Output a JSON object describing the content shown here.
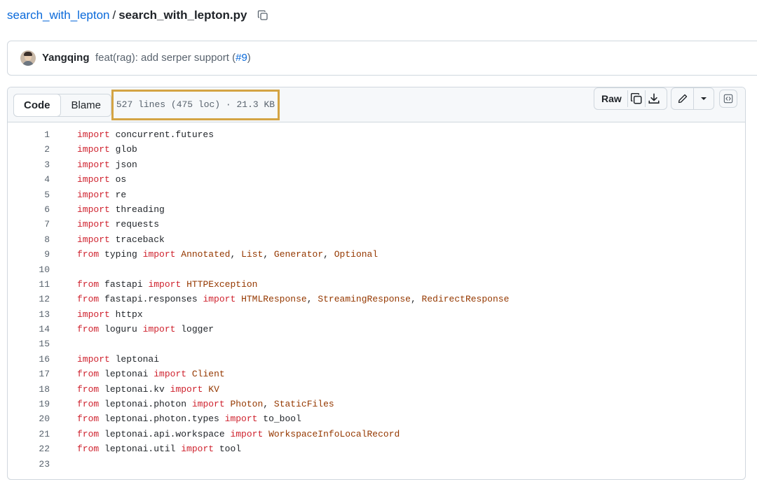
{
  "breadcrumb": {
    "repo": "search_with_lepton",
    "separator": "/",
    "file": "search_with_lepton.py"
  },
  "commit": {
    "author": "Yangqing",
    "message_prefix": "feat(rag): add serper support (",
    "pr_link": "#9",
    "message_suffix": ")"
  },
  "file_header": {
    "code_tab": "Code",
    "blame_tab": "Blame",
    "stats": "527 lines (475 loc) · 21.3 KB",
    "raw_label": "Raw"
  },
  "code_lines": [
    [
      {
        "t": "import",
        "k": "kw"
      },
      {
        "t": " concurrent.futures",
        "k": "tx"
      }
    ],
    [
      {
        "t": "import",
        "k": "kw"
      },
      {
        "t": " glob",
        "k": "tx"
      }
    ],
    [
      {
        "t": "import",
        "k": "kw"
      },
      {
        "t": " json",
        "k": "tx"
      }
    ],
    [
      {
        "t": "import",
        "k": "kw"
      },
      {
        "t": " os",
        "k": "tx"
      }
    ],
    [
      {
        "t": "import",
        "k": "kw"
      },
      {
        "t": " re",
        "k": "tx"
      }
    ],
    [
      {
        "t": "import",
        "k": "kw"
      },
      {
        "t": " threading",
        "k": "tx"
      }
    ],
    [
      {
        "t": "import",
        "k": "kw"
      },
      {
        "t": " requests",
        "k": "tx"
      }
    ],
    [
      {
        "t": "import",
        "k": "kw"
      },
      {
        "t": " traceback",
        "k": "tx"
      }
    ],
    [
      {
        "t": "from",
        "k": "kw"
      },
      {
        "t": " typing ",
        "k": "tx"
      },
      {
        "t": "import",
        "k": "kw"
      },
      {
        "t": " ",
        "k": "tx"
      },
      {
        "t": "Annotated",
        "k": "cls"
      },
      {
        "t": ", ",
        "k": "tx"
      },
      {
        "t": "List",
        "k": "cls"
      },
      {
        "t": ", ",
        "k": "tx"
      },
      {
        "t": "Generator",
        "k": "cls"
      },
      {
        "t": ", ",
        "k": "tx"
      },
      {
        "t": "Optional",
        "k": "cls"
      }
    ],
    [],
    [
      {
        "t": "from",
        "k": "kw"
      },
      {
        "t": " fastapi ",
        "k": "tx"
      },
      {
        "t": "import",
        "k": "kw"
      },
      {
        "t": " ",
        "k": "tx"
      },
      {
        "t": "HTTPException",
        "k": "cls"
      }
    ],
    [
      {
        "t": "from",
        "k": "kw"
      },
      {
        "t": " fastapi.responses ",
        "k": "tx"
      },
      {
        "t": "import",
        "k": "kw"
      },
      {
        "t": " ",
        "k": "tx"
      },
      {
        "t": "HTMLResponse",
        "k": "cls"
      },
      {
        "t": ", ",
        "k": "tx"
      },
      {
        "t": "StreamingResponse",
        "k": "cls"
      },
      {
        "t": ", ",
        "k": "tx"
      },
      {
        "t": "RedirectResponse",
        "k": "cls"
      }
    ],
    [
      {
        "t": "import",
        "k": "kw"
      },
      {
        "t": " httpx",
        "k": "tx"
      }
    ],
    [
      {
        "t": "from",
        "k": "kw"
      },
      {
        "t": " loguru ",
        "k": "tx"
      },
      {
        "t": "import",
        "k": "kw"
      },
      {
        "t": " logger",
        "k": "tx"
      }
    ],
    [],
    [
      {
        "t": "import",
        "k": "kw"
      },
      {
        "t": " leptonai",
        "k": "tx"
      }
    ],
    [
      {
        "t": "from",
        "k": "kw"
      },
      {
        "t": " leptonai ",
        "k": "tx"
      },
      {
        "t": "import",
        "k": "kw"
      },
      {
        "t": " ",
        "k": "tx"
      },
      {
        "t": "Client",
        "k": "cls"
      }
    ],
    [
      {
        "t": "from",
        "k": "kw"
      },
      {
        "t": " leptonai.kv ",
        "k": "tx"
      },
      {
        "t": "import",
        "k": "kw"
      },
      {
        "t": " ",
        "k": "tx"
      },
      {
        "t": "KV",
        "k": "cls"
      }
    ],
    [
      {
        "t": "from",
        "k": "kw"
      },
      {
        "t": " leptonai.photon ",
        "k": "tx"
      },
      {
        "t": "import",
        "k": "kw"
      },
      {
        "t": " ",
        "k": "tx"
      },
      {
        "t": "Photon",
        "k": "cls"
      },
      {
        "t": ", ",
        "k": "tx"
      },
      {
        "t": "StaticFiles",
        "k": "cls"
      }
    ],
    [
      {
        "t": "from",
        "k": "kw"
      },
      {
        "t": " leptonai.photon.types ",
        "k": "tx"
      },
      {
        "t": "import",
        "k": "kw"
      },
      {
        "t": " to_bool",
        "k": "tx"
      }
    ],
    [
      {
        "t": "from",
        "k": "kw"
      },
      {
        "t": " leptonai.api.workspace ",
        "k": "tx"
      },
      {
        "t": "import",
        "k": "kw"
      },
      {
        "t": " ",
        "k": "tx"
      },
      {
        "t": "WorkspaceInfoLocalRecord",
        "k": "cls"
      }
    ],
    [
      {
        "t": "from",
        "k": "kw"
      },
      {
        "t": " leptonai.util ",
        "k": "tx"
      },
      {
        "t": "import",
        "k": "kw"
      },
      {
        "t": " tool",
        "k": "tx"
      }
    ],
    []
  ],
  "colors": {
    "link": "#0969da",
    "keyword": "#cf222e",
    "class_name": "#953800",
    "highlight_box": "#d4a444",
    "border": "#d0d7de"
  }
}
